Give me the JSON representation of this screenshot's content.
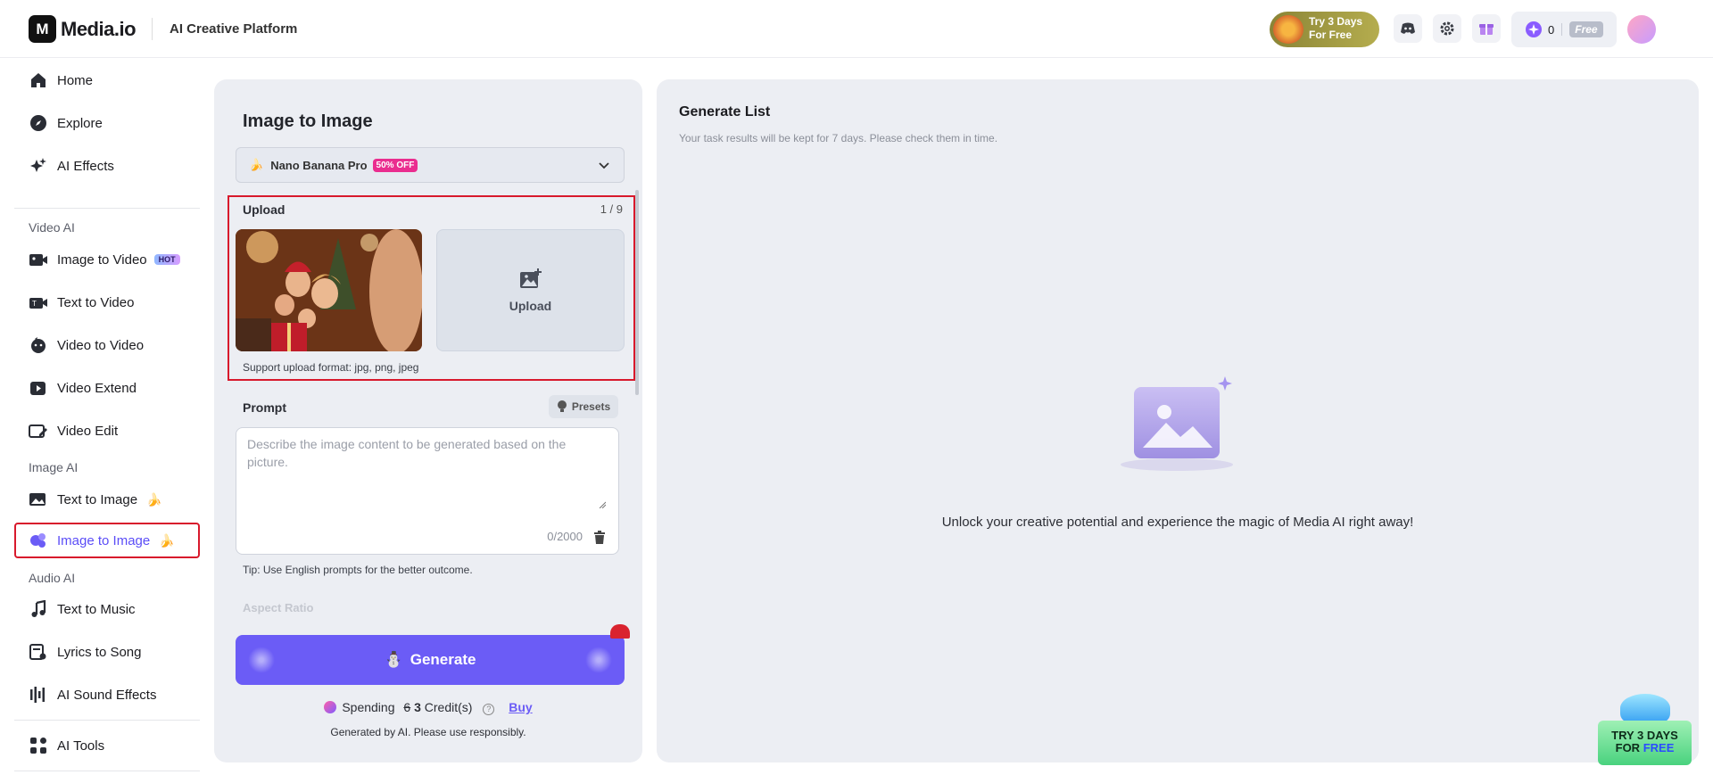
{
  "header": {
    "logo_text": "Media.io",
    "platform": "AI Creative Platform",
    "trial": {
      "line1": "Try 3 Days",
      "line2": "For Free"
    },
    "credits": "0",
    "plan_badge": "Free",
    "icons": [
      "discord-icon",
      "settings-icon",
      "gift-icon",
      "credit-icon",
      "avatar"
    ]
  },
  "sidebar": {
    "top_items": [
      {
        "label": "Home",
        "icon": "home-icon"
      },
      {
        "label": "Explore",
        "icon": "compass-icon"
      },
      {
        "label": "AI Effects",
        "icon": "sparkle-icon"
      }
    ],
    "video_section": "Video AI",
    "video_items": [
      {
        "label": "Image to Video",
        "badge": "HOT"
      },
      {
        "label": "Text to Video"
      },
      {
        "label": "Video to Video"
      },
      {
        "label": "Video Extend"
      },
      {
        "label": "Video Edit"
      }
    ],
    "image_section": "Image AI",
    "image_items": [
      {
        "label": "Text to Image",
        "emoji": "🍌"
      },
      {
        "label": "Image to Image",
        "emoji": "🍌",
        "active": true
      }
    ],
    "audio_section": "Audio AI",
    "audio_items": [
      {
        "label": "Text to Music"
      },
      {
        "label": "Lyrics to Song"
      },
      {
        "label": "AI Sound Effects"
      }
    ],
    "tools_item": "AI Tools"
  },
  "panel": {
    "title": "Image to Image",
    "model": {
      "emoji": "🍌",
      "name": "Nano Banana Pro",
      "discount": "50% OFF"
    },
    "upload": {
      "label": "Upload",
      "count": "1 / 9",
      "tile_label": "Upload",
      "formats": "Support upload format: jpg, png, jpeg"
    },
    "prompt": {
      "label": "Prompt",
      "presets": "Presets",
      "placeholder": "Describe the image content to be generated based on the picture.",
      "char_count": "0/2000",
      "tip": "Tip: Use English prompts for the better outcome."
    },
    "next_section_faded": "Aspect Ratio",
    "generate": {
      "emoji": "⛄",
      "label": "Generate"
    },
    "spending": {
      "prefix": "Spending",
      "strike": "6",
      "amount": "3",
      "unit": "Credit(s)",
      "buy": "Buy"
    },
    "disclaimer": "Generated by AI. Please use responsibly."
  },
  "generate_list": {
    "title": "Generate List",
    "subtitle": "Your task results will be kept for 7 days. Please check them in time.",
    "empty_message": "Unlock your creative potential and experience the magic of Media AI right away!"
  },
  "promo": {
    "line1": "TRY 3 DAYS",
    "line2": "FOR",
    "line2_accent": "FREE"
  },
  "colors": {
    "accent": "#6b5cf6",
    "highlight_border": "#d8192c",
    "panel_bg": "#eceef3"
  }
}
